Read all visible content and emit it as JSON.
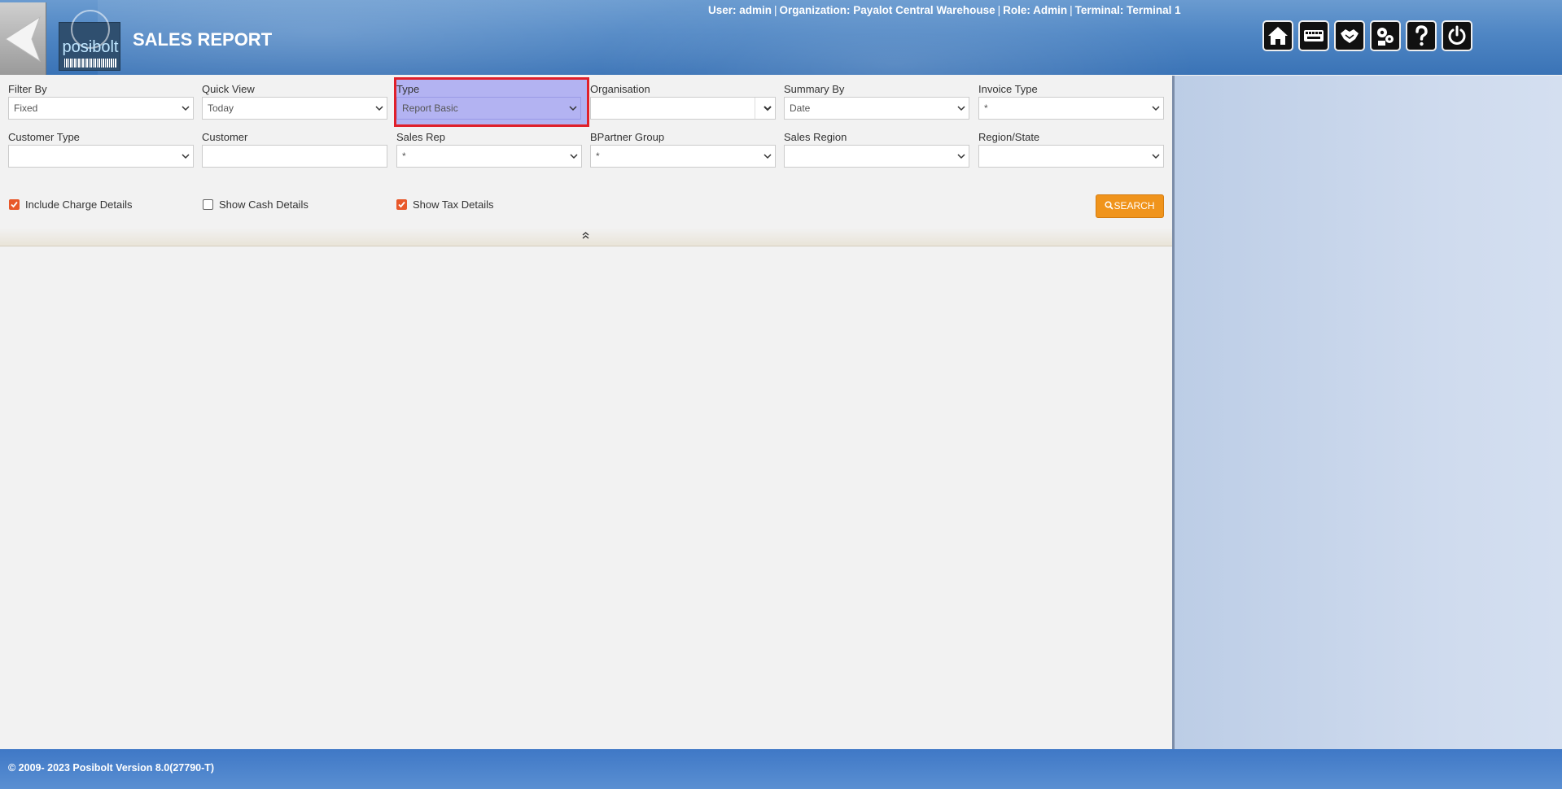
{
  "header": {
    "title": "SALES REPORT",
    "logo_text": "posibolt",
    "user_info": {
      "user": "User: admin",
      "organization": "Organization: Payalot Central Warehouse",
      "role": "Role: Admin",
      "terminal": "Terminal: Terminal 1"
    },
    "toolbar_icons": [
      "home-icon",
      "keyboard-icon",
      "handshake-icon",
      "settings-icon",
      "help-icon",
      "power-icon"
    ]
  },
  "filters": {
    "filter_by": {
      "label": "Filter By",
      "value": "Fixed"
    },
    "quick_view": {
      "label": "Quick View",
      "value": "Today"
    },
    "type": {
      "label": "Type",
      "value": "Report Basic"
    },
    "organisation": {
      "label": "Organisation",
      "value": ""
    },
    "summary_by": {
      "label": "Summary By",
      "value": "Date"
    },
    "invoice_type": {
      "label": "Invoice Type",
      "value": "*"
    },
    "customer_type": {
      "label": "Customer Type",
      "value": ""
    },
    "customer": {
      "label": "Customer",
      "value": ""
    },
    "sales_rep": {
      "label": "Sales Rep",
      "value": "*"
    },
    "bpartner_group": {
      "label": "BPartner Group",
      "value": "*"
    },
    "sales_region": {
      "label": "Sales Region",
      "value": ""
    },
    "region_state": {
      "label": "Region/State",
      "value": ""
    }
  },
  "options": {
    "include_charge_details": {
      "label": "Include Charge Details",
      "checked": true
    },
    "show_cash_details": {
      "label": "Show Cash Details",
      "checked": false
    },
    "show_tax_details": {
      "label": "Show Tax Details",
      "checked": true
    }
  },
  "search_label": "SEARCH",
  "footer": {
    "copyright": "© 2009- 2023 Posibolt Version  8.0(27790-T)"
  },
  "colors": {
    "accent": "#f0941c",
    "checkbox": "#e8582a",
    "highlight": "#b3b3f2",
    "highlight_border": "#e0202a",
    "header": "#4f86c4"
  }
}
